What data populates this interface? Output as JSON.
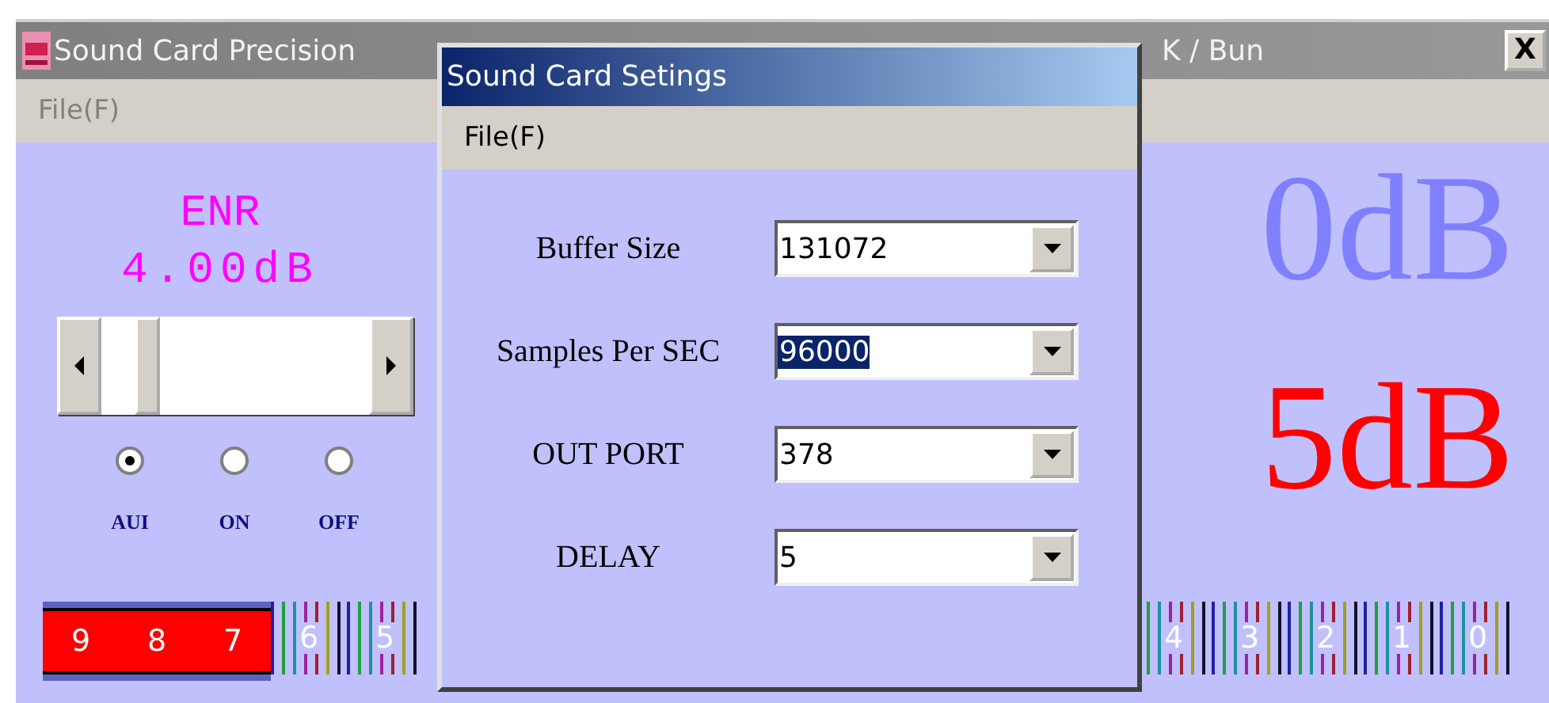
{
  "main_window": {
    "title_left": "Sound Card Precision",
    "title_right": "K / Bun",
    "close_label": "X",
    "menu": [
      "File(F)"
    ],
    "enr": {
      "label": "ENR",
      "value": "4.00dB"
    },
    "slider": {
      "level": 0.13
    },
    "modes": [
      {
        "label": "AUI",
        "selected": true
      },
      {
        "label": "ON",
        "selected": false
      },
      {
        "label": "OFF",
        "selected": false
      }
    ],
    "readings": [
      {
        "text": "0dB",
        "kind": "reference"
      },
      {
        "text": "5dB",
        "kind": "measured"
      }
    ],
    "scale_left": [
      {
        "label": "9",
        "lit": true
      },
      {
        "label": "8",
        "lit": true
      },
      {
        "label": "7",
        "lit": true
      },
      {
        "label": "6",
        "lit": false
      },
      {
        "label": "5",
        "lit": false
      }
    ],
    "scale_right": [
      {
        "label": "4",
        "lit": false
      },
      {
        "label": "3",
        "lit": false
      },
      {
        "label": "2",
        "lit": false
      },
      {
        "label": "1",
        "lit": false
      },
      {
        "label": "0",
        "lit": false
      }
    ]
  },
  "dialog": {
    "title": "Sound Card Setings",
    "menu": [
      "File(F)"
    ],
    "fields": [
      {
        "label": "Buffer Size",
        "value": "131072",
        "highlighted": false
      },
      {
        "label": "Samples Per SEC",
        "value": "96000",
        "highlighted": true
      },
      {
        "label": "OUT PORT",
        "value": "378",
        "highlighted": false
      },
      {
        "label": "DELAY",
        "value": "5",
        "highlighted": false
      }
    ]
  }
}
